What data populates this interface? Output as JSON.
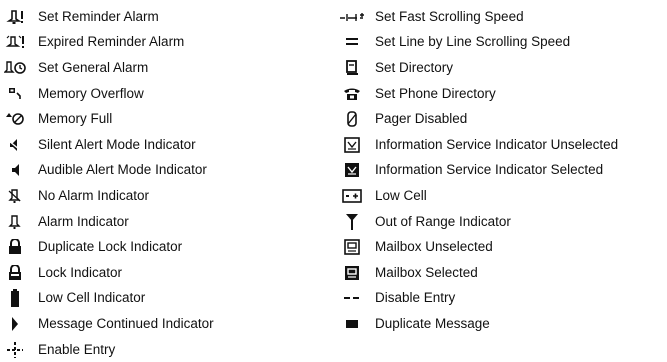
{
  "left_items": [
    {
      "icon": "reminder-alarm-icon",
      "label": "Set Reminder Alarm"
    },
    {
      "icon": "expired-reminder-alarm-icon",
      "label": "Expired Reminder Alarm"
    },
    {
      "icon": "general-alarm-icon",
      "label": "Set General Alarm"
    },
    {
      "icon": "memory-overflow-icon",
      "label": "Memory Overflow"
    },
    {
      "icon": "memory-full-icon",
      "label": "Memory Full"
    },
    {
      "icon": "silent-alert-icon",
      "label": "Silent Alert Mode Indicator"
    },
    {
      "icon": "audible-alert-icon",
      "label": "Audible Alert Mode Indicator"
    },
    {
      "icon": "no-alarm-icon",
      "label": "No Alarm Indicator"
    },
    {
      "icon": "alarm-icon",
      "label": "Alarm Indicator"
    },
    {
      "icon": "duplicate-lock-icon",
      "label": "Duplicate Lock Indicator"
    },
    {
      "icon": "lock-icon",
      "label": "Lock Indicator"
    },
    {
      "icon": "low-cell-bar-icon",
      "label": "Low Cell Indicator"
    },
    {
      "icon": "message-continued-icon",
      "label": "Message Continued Indicator"
    },
    {
      "icon": "enable-entry-icon",
      "label": "Enable Entry"
    }
  ],
  "right_items": [
    {
      "icon": "fast-scroll-icon",
      "label": "Set Fast Scrolling Speed"
    },
    {
      "icon": "line-scroll-icon",
      "label": "Set Line by Line Scrolling Speed"
    },
    {
      "icon": "directory-icon",
      "label": "Set Directory"
    },
    {
      "icon": "phone-directory-icon",
      "label": "Set Phone Directory"
    },
    {
      "icon": "pager-disabled-icon",
      "label": "Pager Disabled"
    },
    {
      "icon": "info-unselected-icon",
      "label": "Information Service Indicator Unselected"
    },
    {
      "icon": "info-selected-icon",
      "label": "Information Service Indicator Selected"
    },
    {
      "icon": "low-cell-icon",
      "label": "Low Cell"
    },
    {
      "icon": "out-of-range-icon",
      "label": "Out of Range Indicator"
    },
    {
      "icon": "mailbox-unselected-icon",
      "label": "Mailbox Unselected"
    },
    {
      "icon": "mailbox-selected-icon",
      "label": "Mailbox Selected"
    },
    {
      "icon": "disable-entry-icon",
      "label": "Disable Entry"
    },
    {
      "icon": "duplicate-message-icon",
      "label": "Duplicate Message"
    }
  ]
}
